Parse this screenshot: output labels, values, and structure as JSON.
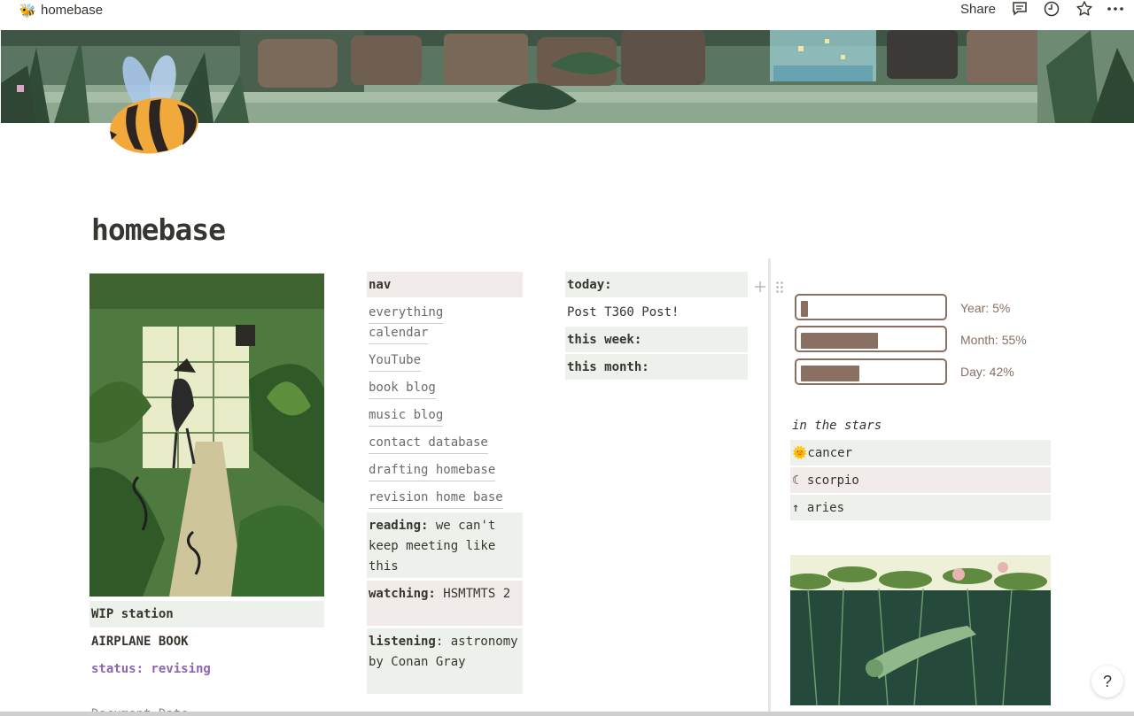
{
  "topbar": {
    "page_icon": "🐝",
    "title": "homebase",
    "share_label": "Share",
    "icons": [
      "comment-icon",
      "history-clock-icon",
      "favorite-star-icon",
      "more-options-icon"
    ]
  },
  "page": {
    "title": "homebase"
  },
  "wip": {
    "header": "WIP station",
    "book": "AIRPLANE BOOK",
    "status": "status: revising",
    "status_color": "#9065b0",
    "cut_text": "Document Date"
  },
  "nav": {
    "header": "nav",
    "links": [
      "everything",
      "calendar",
      "YouTube",
      "book blog",
      "music blog",
      "contact database",
      "drafting homebase",
      "revision home base"
    ]
  },
  "media": {
    "reading_label": "reading:",
    "reading_value": " we can't keep meeting like this",
    "watching_label": "watching:",
    "watching_value": " HSMTMTS 2",
    "listening_label": "listening",
    "listening_value": ": astronomy by Conan Gray"
  },
  "todo": {
    "today_label": "today:",
    "today_item": "Post T360 Post!",
    "week_label": "this week:",
    "month_label": "this month:"
  },
  "progress": [
    {
      "label": "Year: 5%",
      "value": 0.05
    },
    {
      "label": "Month: 55%",
      "value": 0.55
    },
    {
      "label": "Day: 42%",
      "value": 0.42
    }
  ],
  "stars": {
    "title": "in the stars",
    "sun": "🌞cancer",
    "moon": "☾ scorpio",
    "rising": "↑ aries"
  },
  "help_label": "?",
  "colors": {
    "progress": "#8a6f63",
    "green_block": "#edf1ec",
    "pink_block": "#f1ece9"
  }
}
